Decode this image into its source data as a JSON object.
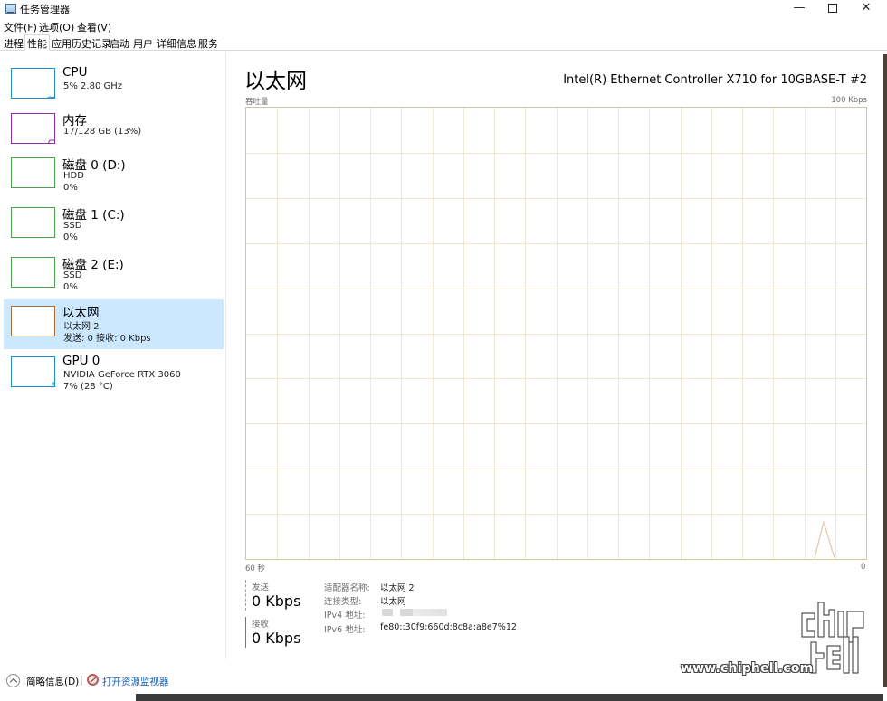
{
  "window": {
    "title": "任务管理器",
    "minimize": "—",
    "close": "✕"
  },
  "menu": [
    "文件(F)",
    "选项(O)",
    "查看(V)"
  ],
  "tabs": [
    "进程",
    "性能",
    "应用历史记录",
    "启动",
    "用户",
    "详细信息",
    "服务"
  ],
  "active_tab": "性能",
  "sidebar": {
    "items": [
      {
        "title": "CPU",
        "sub1": "5%  2.80 GHz",
        "sub2": "",
        "color": "#1f8ec9"
      },
      {
        "title": "内存",
        "sub1": "17/128 GB (13%)",
        "sub2": "",
        "color": "#8b2fa8"
      },
      {
        "title": "磁盘 0 (D:)",
        "sub1": "HDD",
        "sub2": "0%",
        "color": "#4da34d"
      },
      {
        "title": "磁盘 1 (C:)",
        "sub1": "SSD",
        "sub2": "0%",
        "color": "#4da34d"
      },
      {
        "title": "磁盘 2 (E:)",
        "sub1": "SSD",
        "sub2": "0%",
        "color": "#4da34d"
      },
      {
        "title": "以太网",
        "sub1": "以太网 2",
        "sub2": "发送: 0 接收: 0 Kbps",
        "color": "#a86c3a",
        "selected": true
      },
      {
        "title": "GPU 0",
        "sub1": "NVIDIA GeForce RTX 3060",
        "sub2": "7% (28 °C)",
        "color": "#1f8ec9"
      }
    ]
  },
  "main": {
    "title": "以太网",
    "adapter": "Intel(R) Ethernet Controller X710 for 10GBASE-T #2",
    "graph_label": "吞吐量",
    "graph_max": "100 Kbps",
    "graph_time": "60 秒",
    "graph_min": "0",
    "graph_color": "#a86c3a",
    "grid_color": "#efe9d4"
  },
  "stats": {
    "send_label": "发送",
    "send_value": "0 Kbps",
    "recv_label": "接收",
    "recv_value": "0 Kbps"
  },
  "info": {
    "adapter_name_label": "适配器名称:",
    "adapter_name_value": "以太网 2",
    "connection_type_label": "连接类型:",
    "connection_type_value": "以太网",
    "ipv4_label": "IPv4 地址:",
    "ipv6_label": "IPv6 地址:",
    "ipv6_value": "fe80::30f9:660d:8c8a:a8e7%12"
  },
  "bottom": {
    "fewer_details": "简略信息(D)",
    "separator": "|",
    "open_monitor": "打开资源监视器"
  },
  "watermark": {
    "text": "www.chiphell.com",
    "logo": "chip hell"
  }
}
